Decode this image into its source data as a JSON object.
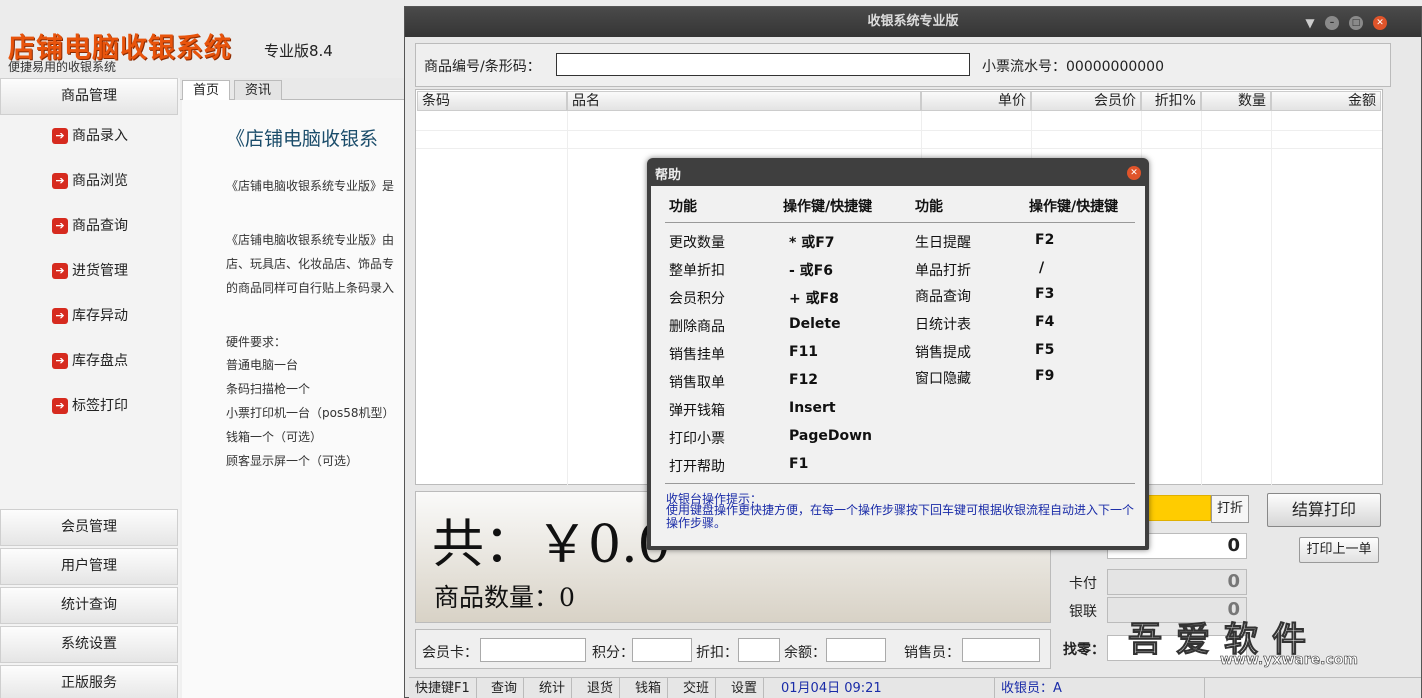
{
  "app": {
    "title": "店铺电脑收银系统",
    "edition": "专业版8.4",
    "slogan": "便捷易用的收银系统"
  },
  "sidebar": {
    "group_main": "商品管理",
    "sub_items": [
      {
        "label": "商品录入",
        "icon": "red-arrow-icon"
      },
      {
        "label": "商品浏览",
        "icon": "red-arrow-icon"
      },
      {
        "label": "商品查询",
        "icon": "red-arrow-icon"
      },
      {
        "label": "进货管理",
        "icon": "red-arrow-icon"
      },
      {
        "label": "库存异动",
        "icon": "red-arrow-icon"
      },
      {
        "label": "库存盘点",
        "icon": "red-arrow-icon"
      },
      {
        "label": "标签打印",
        "icon": "red-arrow-icon"
      }
    ],
    "groups": [
      "会员管理",
      "用户管理",
      "统计查询",
      "系统设置",
      "正版服务"
    ]
  },
  "tabs": [
    "首页",
    "资讯"
  ],
  "content": {
    "title": "《店铺电脑收银系",
    "lines": [
      "《店铺电脑收银系统专业版》是",
      "《店铺电脑收银系统专业版》由",
      "店、玩具店、化妆品店、饰品专",
      "的商品同样可自行贴上条码录入",
      "硬件要求：",
      "普通电脑一台",
      "条码扫描枪一个",
      "小票打印机一台（pos58机型）",
      "钱箱一个（可选）",
      "顾客显示屏一个（可选）"
    ]
  },
  "pos": {
    "window_title": "收银系统专业版",
    "scan_label": "商品编号/条形码：",
    "scan_value": "",
    "serial_label": "小票流水号：00000000000",
    "columns": [
      "条码",
      "品名",
      "单价",
      "会员价",
      "折扣%",
      "数量",
      "金额"
    ],
    "total": "共：￥0.0",
    "item_count": "商品数量：0",
    "discount_button": "打折",
    "checkout_button": "结算打印",
    "reprint_button": "打印上一单",
    "payment_value": "0",
    "card_label": "卡付",
    "card_value": "0",
    "unionpay_label": "银联",
    "unionpay_value": "0",
    "change_label": "找零：",
    "member_card_label": "会员卡：",
    "points_label": "积分：",
    "discount_label": "折扣：",
    "balance_label": "余额：",
    "salesperson_label": "销售员：",
    "status": {
      "items": [
        "快捷键F1",
        "查询",
        "统计",
        "退货",
        "钱箱",
        "交班",
        "设置"
      ],
      "datetime": "01月04日  09:21",
      "cashier": "收银员：A"
    }
  },
  "help": {
    "title": "帮助",
    "headers": [
      "功能",
      "操作键/快捷键",
      "功能",
      "操作键/快捷键"
    ],
    "left": [
      {
        "func": "更改数量",
        "key": "* 或F7"
      },
      {
        "func": "整单折扣",
        "key": "- 或F6"
      },
      {
        "func": "会员积分",
        "key": "+ 或F8"
      },
      {
        "func": "删除商品",
        "key": "Delete"
      },
      {
        "func": "销售挂单",
        "key": "F11"
      },
      {
        "func": "销售取单",
        "key": "F12"
      },
      {
        "func": "弹开钱箱",
        "key": "Insert"
      },
      {
        "func": "打印小票",
        "key": "PageDown"
      },
      {
        "func": "打开帮助",
        "key": "F1"
      }
    ],
    "right": [
      {
        "func": "生日提醒",
        "key": "F2"
      },
      {
        "func": "单品打折",
        "key": "/"
      },
      {
        "func": "商品查询",
        "key": "F3"
      },
      {
        "func": "日统计表",
        "key": "F4"
      },
      {
        "func": "销售提成",
        "key": "F5"
      },
      {
        "func": "窗口隐藏",
        "key": "F9"
      }
    ],
    "tip_title": "收银台操作提示：",
    "tip_text": "使用键盘操作更快捷方便，在每一个操作步骤按下回车键可根据收银流程自动进入下一个操作步骤。"
  },
  "watermark": {
    "brand": "吾爱软件",
    "url": "www.yxware.com"
  },
  "colors": {
    "brand_orange": "#e8540c",
    "highlight_yellow": "#ffcc00",
    "tip_blue": "#1a2ca8",
    "dialog_dark": "#3f3f3f"
  }
}
